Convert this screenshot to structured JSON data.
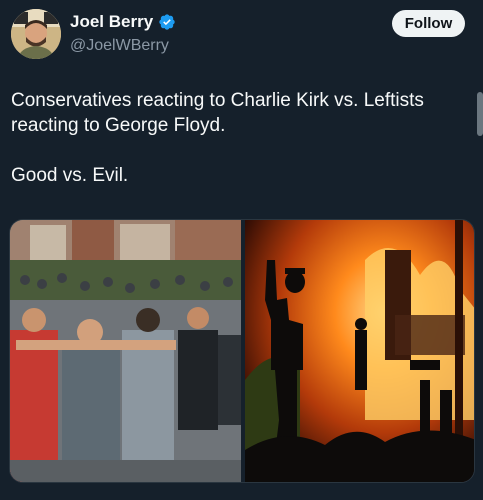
{
  "author": {
    "display_name": "Joel Berry",
    "handle": "@JoelWBerry",
    "avatar_icon": "avatar-photo",
    "verified_icon": "verified-badge-icon",
    "verified_color": "#1d9bf0"
  },
  "actions": {
    "follow_label": "Follow"
  },
  "tweet": {
    "line1": "Conservatives reacting to Charlie Kirk vs. Leftists reacting to George Floyd.",
    "line2": "Good vs. Evil."
  },
  "media": {
    "left_photo_icon": "crowd-prayer-photo",
    "right_photo_icon": "riot-fire-photo"
  },
  "colors": {
    "background": "#15202b",
    "text": "#f7f9f9",
    "secondary_text": "#8b98a5",
    "follow_bg": "#eff3f4"
  }
}
